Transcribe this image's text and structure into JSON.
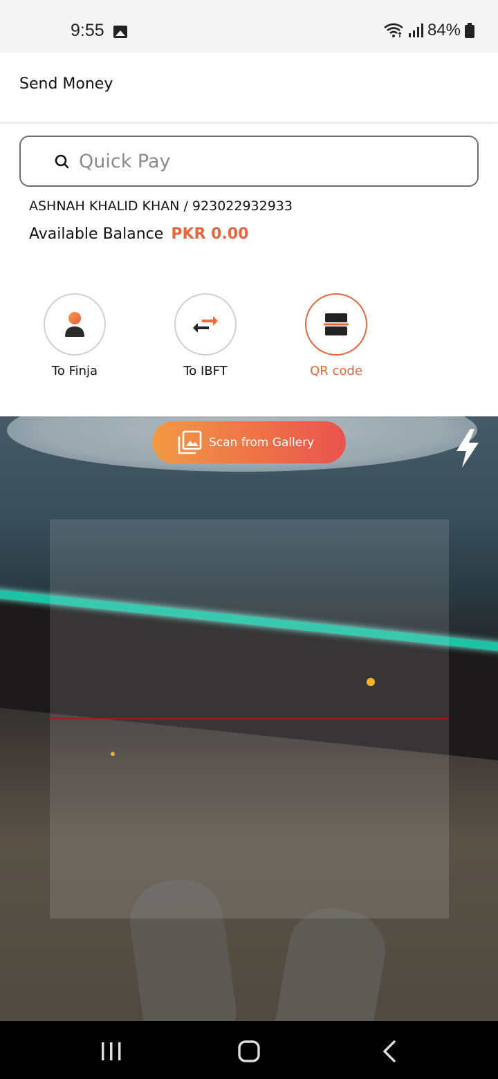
{
  "status_bar": {
    "time": "9:55",
    "battery": "84%"
  },
  "header": {
    "title": "Send Money"
  },
  "search": {
    "placeholder": "Quick Pay",
    "value": ""
  },
  "account": {
    "name_number": "ASHNAH KHALID KHAN / 923022932933",
    "balance_label": "Available Balance",
    "balance_value": "PKR 0.00"
  },
  "actions": [
    {
      "label": "To Finja",
      "icon": "person-icon"
    },
    {
      "label": "To IBFT",
      "icon": "transfer-arrows-icon"
    },
    {
      "label": "QR code",
      "icon": "qr-scan-icon",
      "active": true
    }
  ],
  "camera": {
    "gallery_label": "Scan from Gallery"
  },
  "colors": {
    "accent": "#e8663b",
    "scan_line": "#b0141b"
  }
}
